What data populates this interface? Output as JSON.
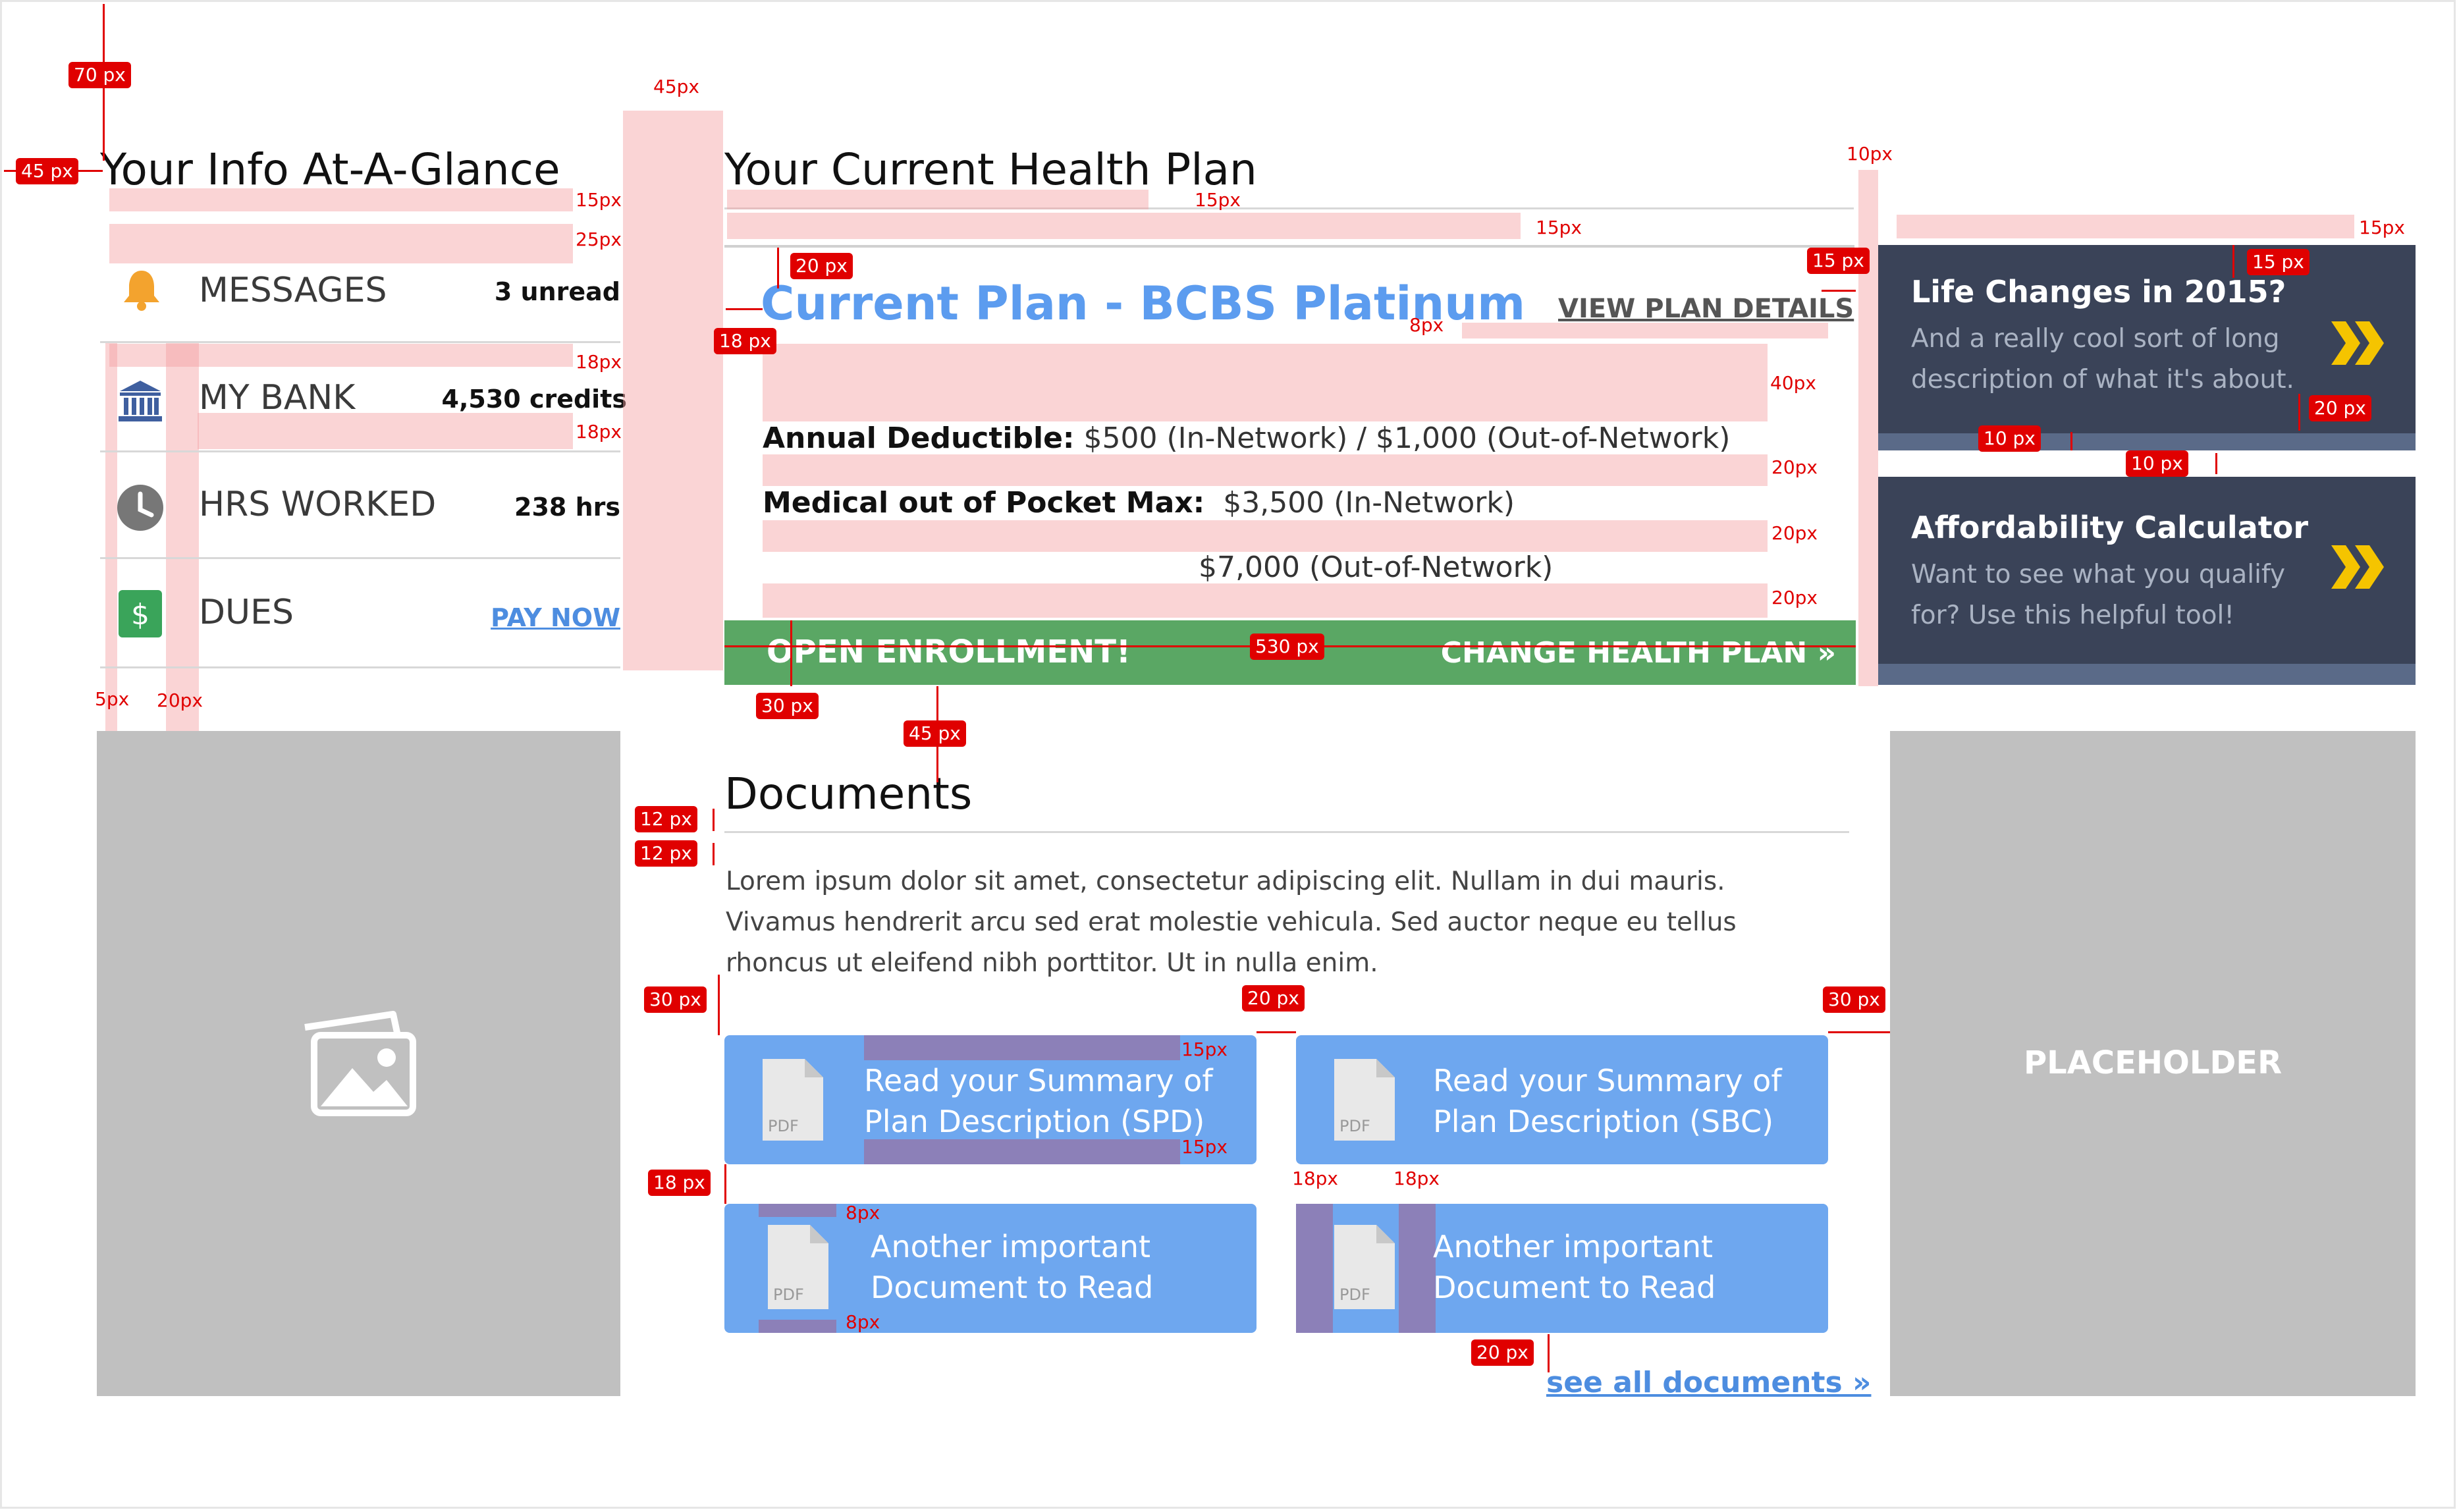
{
  "info": {
    "title": "Your Info At-A-Glance",
    "rows": [
      {
        "label": "MESSAGES",
        "value": "3 unread",
        "icon": "bell-icon"
      },
      {
        "label": "MY BANK",
        "value": "4,530 credits",
        "icon": "bank-icon"
      },
      {
        "label": "HRS WORKED",
        "value": "238 hrs",
        "icon": "clock-icon"
      },
      {
        "label": "DUES",
        "value": "PAY NOW",
        "icon": "dollar-icon"
      }
    ]
  },
  "plan": {
    "title": "Your Current Health Plan",
    "name": "Current Plan - BCBS Platinum",
    "details_link": "VIEW PLAN DETAILS",
    "deductible_label": "Annual Deductible:",
    "deductible_value": "$500 (In-Network) / $1,000 (Out-of-Network)",
    "oop_label": "Medical out of Pocket Max:",
    "oop_value_1": "$3,500 (In-Network)",
    "oop_value_2": "$7,000 (Out-of-Network)",
    "banner_left": "OPEN ENROLLMENT!",
    "banner_right": "CHANGE HEALTH PLAN »"
  },
  "side_cards": [
    {
      "title": "Life Changes in 2015?",
      "desc_1": "And a really cool sort of long",
      "desc_2": "description of what it's about."
    },
    {
      "title": "Affordability Calculator",
      "desc_1": "Want to see what you qualify",
      "desc_2": "for? Use this helpful tool!"
    }
  ],
  "documents": {
    "title": "Documents",
    "body_1": "Lorem ipsum dolor sit amet, consectetur adipiscing elit. Nullam in dui mauris.",
    "body_2": "Vivamus hendrerit arcu sed erat molestie vehicula. Sed auctor neque eu tellus",
    "body_3": "rhoncus ut eleifend nibh porttitor. Ut in nulla enim.",
    "cards": [
      {
        "line_1": "Read your Summary of",
        "line_2": "Plan Description (SPD)"
      },
      {
        "line_1": "Read your Summary of",
        "line_2": "Plan Description (SBC)"
      },
      {
        "line_1": "Another important",
        "line_2": "Document to Read"
      },
      {
        "line_1": "Another important",
        "line_2": "Document to Read"
      }
    ],
    "pdf_label": "PDF",
    "see_all": "see all documents »"
  },
  "placeholder_label": "PLACEHOLDER",
  "annotations": {
    "a70": "70 px",
    "a45a": "45 px",
    "a45b": "45px",
    "a15a": "15px",
    "a25": "25px",
    "a18a": "18px",
    "a18b": "18px",
    "a5": "5px",
    "a20a": "20px",
    "a15b": "15px",
    "a15c": "15px",
    "a10": "10px",
    "a15d": "15px",
    "a20b": "20 px",
    "a18c": "18 px",
    "a15e": "15 px",
    "a8a": "8px",
    "a40": "40px",
    "a20c": "20px",
    "a20d": "20px",
    "a20e": "20px",
    "a530": "530 px",
    "a30a": "30 px",
    "a45c": "45 px",
    "a15f": "15 px",
    "a20f": "20 px",
    "a10a": "10 px",
    "a10b": "10 px",
    "a12a": "12 px",
    "a12b": "12 px",
    "a30b": "30 px",
    "a20g": "20 px",
    "a30c": "30 px",
    "a15g": "15px",
    "a15h": "15px",
    "a18d": "18 px",
    "a8b": "8px",
    "a8c": "8px",
    "a18e": "18px",
    "a18f": "18px",
    "a20h": "20 px"
  },
  "colors": {
    "accent_blue": "#4d8de0",
    "card_blue": "#6ea7ef",
    "green_banner": "#5aa764",
    "dark_card": "#3a4358",
    "arrow_yellow": "#f5c400",
    "annotation_red": "#e00000"
  }
}
